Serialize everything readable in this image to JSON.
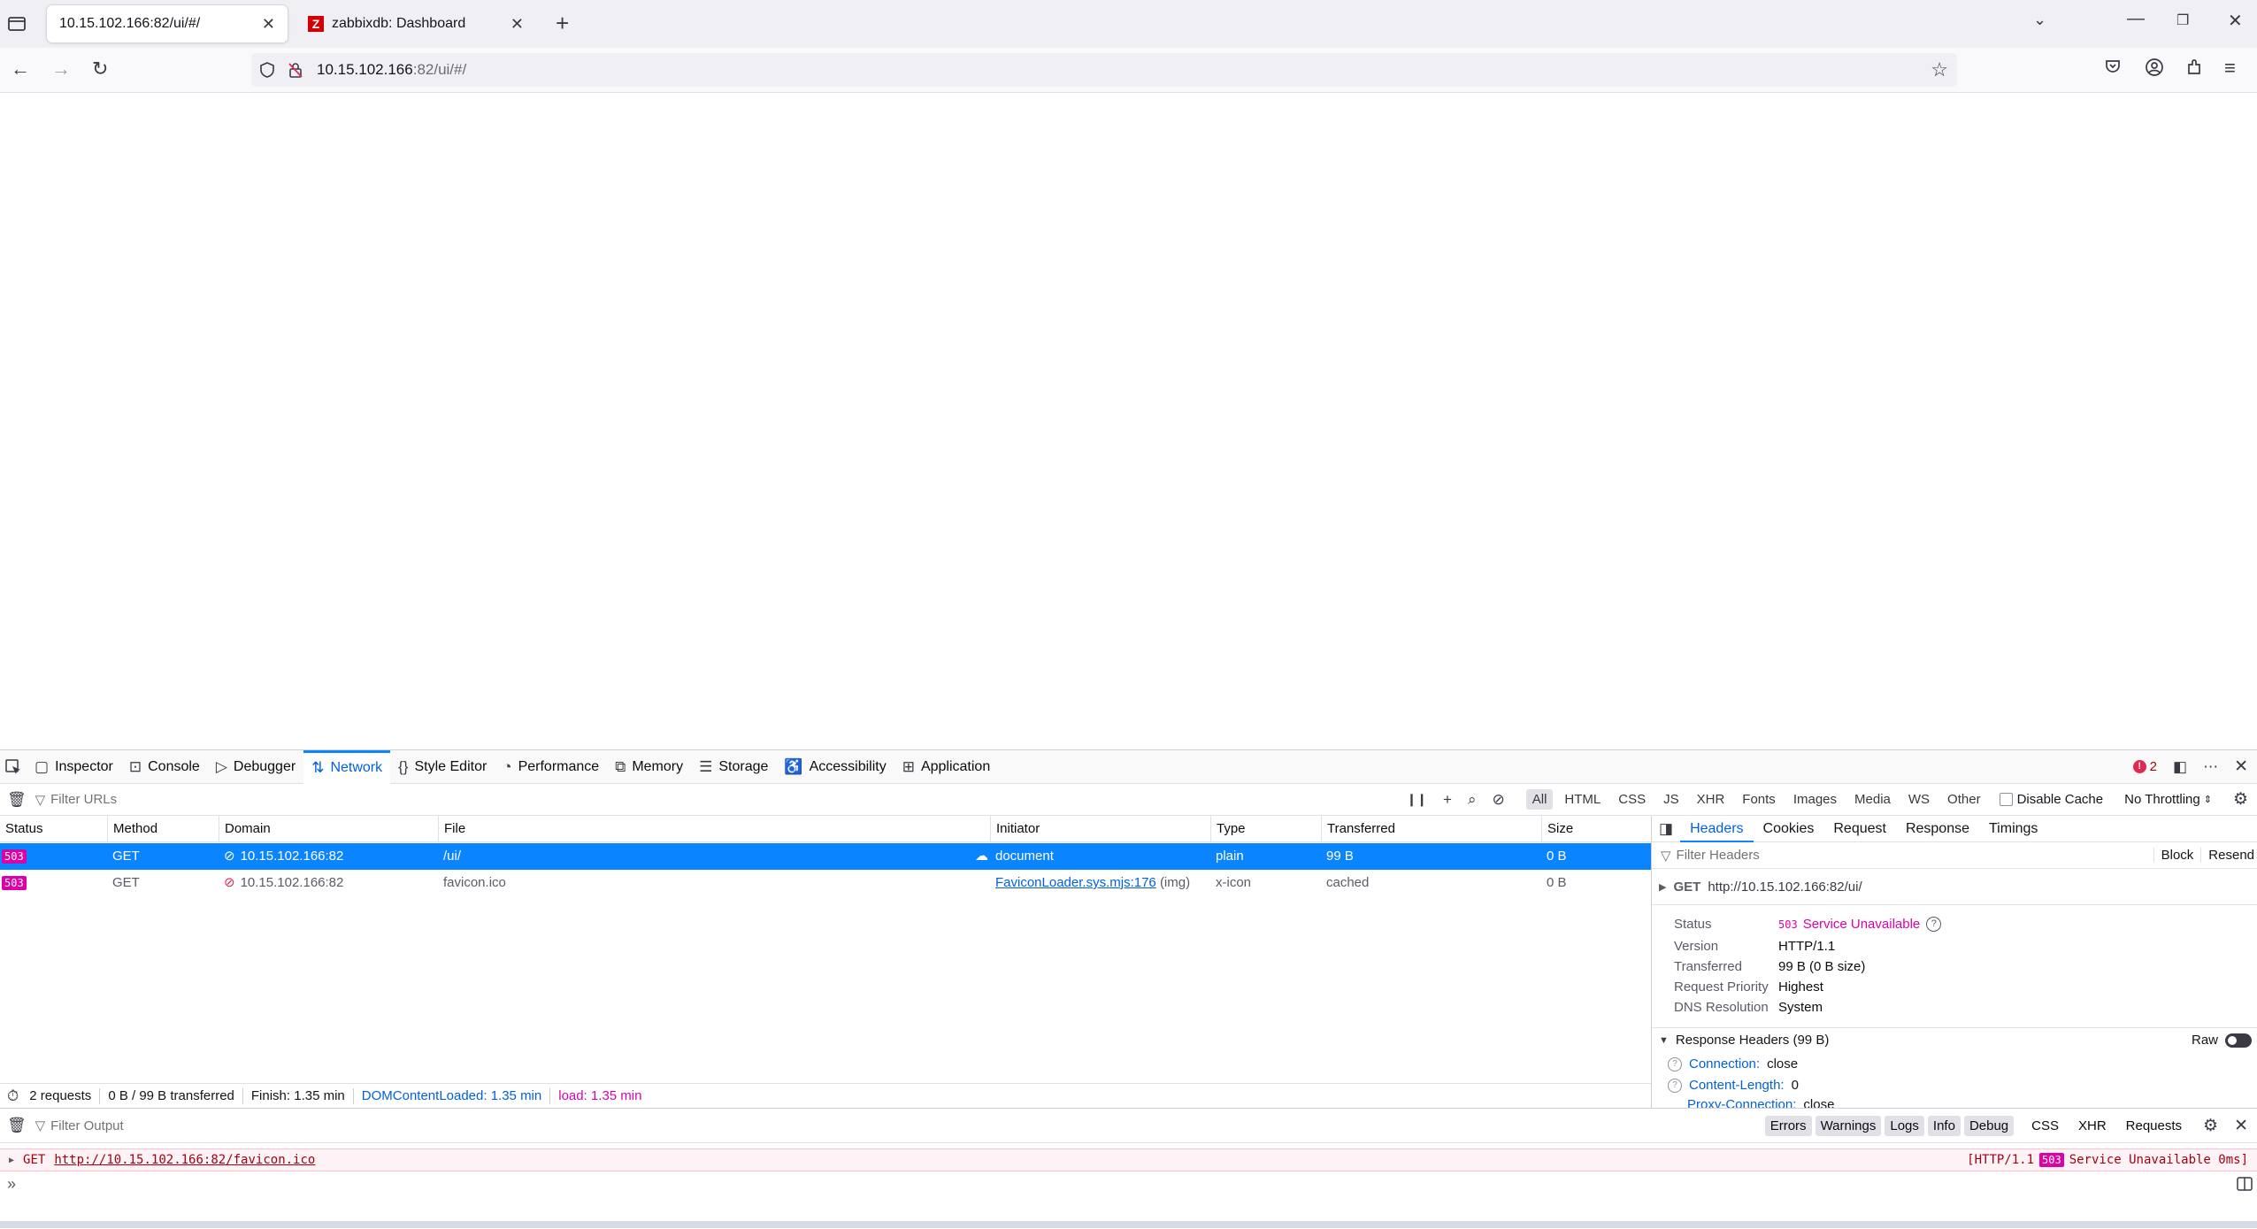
{
  "browser": {
    "tabs": [
      {
        "title": "10.15.102.166:82/ui/#/",
        "active": true
      },
      {
        "title": "zabbixdb: Dashboard",
        "active": false,
        "favicon_letter": "Z"
      }
    ],
    "url_host": "10.15.102.166",
    "url_rest": ":82/ui/#/"
  },
  "devtools": {
    "tabs": [
      "Inspector",
      "Console",
      "Debugger",
      "Network",
      "Style Editor",
      "Performance",
      "Memory",
      "Storage",
      "Accessibility",
      "Application"
    ],
    "active_tab": "Network",
    "error_count": "2",
    "filter_urls_placeholder": "Filter URLs",
    "filter_types": [
      "All",
      "HTML",
      "CSS",
      "JS",
      "XHR",
      "Fonts",
      "Images",
      "Media",
      "WS",
      "Other"
    ],
    "disable_cache": "Disable Cache",
    "throttling": "No Throttling",
    "columns": [
      "Status",
      "Method",
      "Domain",
      "File",
      "Initiator",
      "Type",
      "Transferred",
      "Size"
    ],
    "requests": [
      {
        "status": "503",
        "method": "GET",
        "domain": "10.15.102.166:82",
        "file": "/ui/",
        "initiator": "document",
        "initiator_extra": "",
        "type": "plain",
        "transferred": "99 B",
        "size": "0 B",
        "selected": true
      },
      {
        "status": "503",
        "method": "GET",
        "domain": "10.15.102.166:82",
        "file": "favicon.ico",
        "initiator": "FaviconLoader.sys.mjs:176",
        "initiator_extra": "(img)",
        "type": "x-icon",
        "transferred": "cached",
        "size": "0 B",
        "selected": false
      }
    ],
    "summary": {
      "requests": "2 requests",
      "transferred": "0 B / 99 B transferred",
      "finish": "Finish: 1.35 min",
      "dom": "DOMContentLoaded: 1.35 min",
      "load": "load: 1.35 min"
    },
    "side_panel": {
      "tabs": [
        "Headers",
        "Cookies",
        "Request",
        "Response",
        "Timings"
      ],
      "filter_placeholder": "Filter Headers",
      "block": "Block",
      "resend": "Resend",
      "request_line_method": "GET",
      "request_line_url": "http://10.15.102.166:82/ui/",
      "status_label": "Status",
      "status_code": "503",
      "status_text": "Service Unavailable",
      "fields": [
        {
          "label": "Version",
          "value": "HTTP/1.1"
        },
        {
          "label": "Transferred",
          "value": "99 B (0 B size)"
        },
        {
          "label": "Request Priority",
          "value": "Highest"
        },
        {
          "label": "DNS Resolution",
          "value": "System"
        }
      ],
      "response_headers_title": "Response Headers (99 B)",
      "raw": "Raw",
      "response_headers": [
        {
          "name": "Connection:",
          "value": "close"
        },
        {
          "name": "Content-Length:",
          "value": "0"
        },
        {
          "name": "Proxy-Connection:",
          "value": "close"
        }
      ]
    },
    "console": {
      "filter_placeholder": "Filter Output",
      "buttons": [
        "Errors",
        "Warnings",
        "Logs",
        "Info",
        "Debug"
      ],
      "extra_buttons": [
        "CSS",
        "XHR",
        "Requests"
      ],
      "message_method": "GET",
      "message_url": "http://10.15.102.166:82/favicon.ico",
      "message_proto": "[HTTP/1.1",
      "message_code": "503",
      "message_status": "Service Unavailable 0ms]",
      "prompt": "»"
    }
  }
}
